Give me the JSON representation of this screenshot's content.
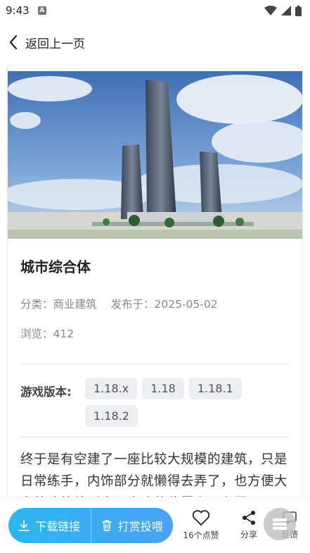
{
  "status_bar": {
    "time": "9:43",
    "notification_badge": "A"
  },
  "nav": {
    "back_label": "返回上一页"
  },
  "post": {
    "title": "城市综合体",
    "category": "分类：商业建筑",
    "published": "发布于：2025-05-02",
    "views": "浏览：412",
    "version_label": "游戏版本:",
    "versions": [
      "1.18.x",
      "1.18",
      "1.18.1",
      "1.18.2"
    ],
    "description": "终于是有空建了一座比较大规模的建筑，只是日常练手，内饰部分就懒得去弄了，也方便大家将建筑放到自己喜欢的位置上，主要"
  },
  "bottom_bar": {
    "download_label": "下载链接",
    "tip_label": "打赏投喂",
    "likes_label": "16个点赞",
    "share_label": "分享",
    "feedback_label": "反馈"
  },
  "colors": {
    "accent_start": "#2db6ee",
    "accent_end": "#4aa2f6"
  },
  "icons": [
    "back-chevron-icon",
    "wifi-icon",
    "signal-icon",
    "battery-icon",
    "download-icon",
    "trash-icon",
    "heart-icon",
    "share-icon",
    "menu-icon"
  ]
}
